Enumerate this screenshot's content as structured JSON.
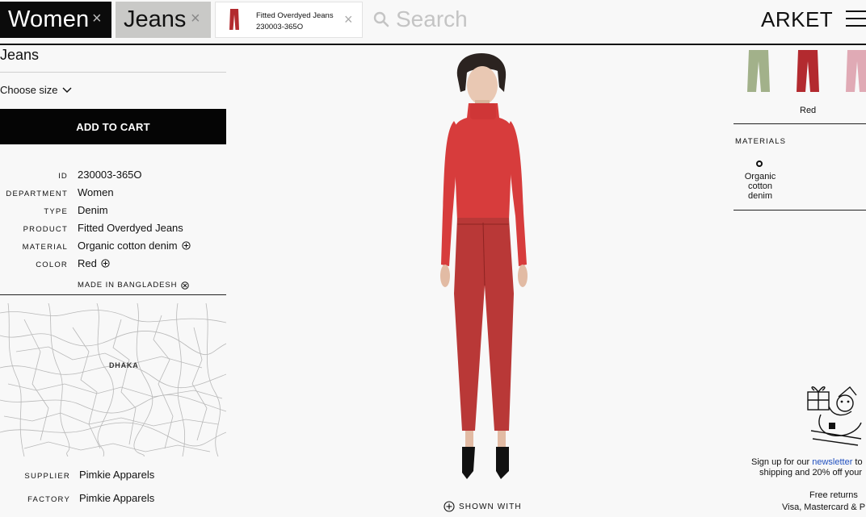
{
  "header": {
    "filters": [
      {
        "label": "Women",
        "close": "×"
      },
      {
        "label": "Jeans",
        "close": "×"
      },
      {
        "label_line1": "Fitted Overdyed Jeans",
        "label_line2": "230003-365O",
        "close": "×"
      }
    ],
    "search_placeholder": "Search",
    "brand": "ARKET"
  },
  "left": {
    "category": "Jeans",
    "choose_size": "Choose size",
    "add_to_cart": "ADD TO CART",
    "specs": [
      {
        "key": "ID",
        "value": "230003-365O"
      },
      {
        "key": "DEPARTMENT",
        "value": "Women"
      },
      {
        "key": "TYPE",
        "value": "Denim"
      },
      {
        "key": "PRODUCT",
        "value": "Fitted Overdyed Jeans"
      },
      {
        "key": "MATERIAL",
        "value": "Organic cotton denim"
      },
      {
        "key": "COLOR",
        "value": "Red"
      }
    ],
    "made_in": "MADE IN BANGLADESH",
    "map_label": "DHAKA",
    "supplier": {
      "key": "SUPPLIER",
      "value": "Pimkie Apparels"
    },
    "factory": {
      "key": "FACTORY",
      "value": "Pimkie Apparels"
    }
  },
  "center": {
    "shown_with": "SHOWN WITH"
  },
  "right": {
    "swatches": [
      {
        "color": "#a2b18a",
        "name": "sage"
      },
      {
        "color": "#b32a2f",
        "name": "red"
      },
      {
        "color": "#e0aab5",
        "name": "pink"
      }
    ],
    "selected_color_label": "Red",
    "materials_heading": "MATERIALS",
    "material_line1": "Organic",
    "material_line2": "cotton",
    "material_line3": "denim",
    "newsletter_pre": "Sign up for our ",
    "newsletter_link": "newsletter",
    "newsletter_post": " to",
    "newsletter_line2": "shipping and 20% off your",
    "returns": "Free returns",
    "cards": "Visa, Mastercard & P"
  },
  "colors": {
    "accent_dark": "#050505",
    "link": "#1f4fbf",
    "garment_red": "#c2393a",
    "top_red": "#d73c3c"
  }
}
